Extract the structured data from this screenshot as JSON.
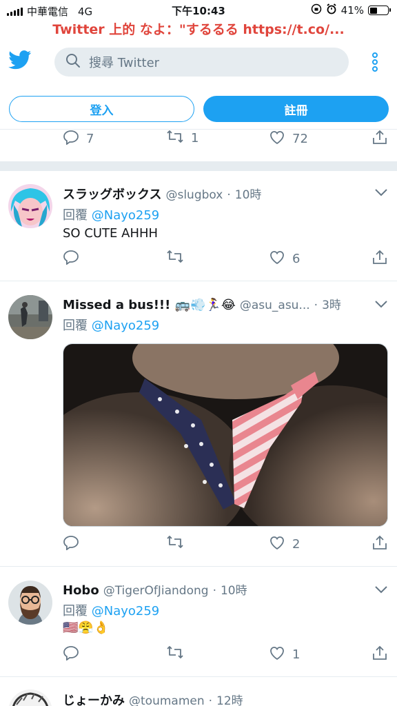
{
  "status_bar": {
    "carrier": "中華電信",
    "network": "4G",
    "time": "下午10:43",
    "battery": "41%",
    "battery_level": 0.41
  },
  "banner": "Twitter 上的 なよ：\"するるる https://t.co/...",
  "header": {
    "search_placeholder": "搜尋 Twitter"
  },
  "auth": {
    "login_label": "登入",
    "signup_label": "註冊"
  },
  "top_actions": {
    "reply_count": "7",
    "retweet_count": "1",
    "like_count": "72"
  },
  "tweets": [
    {
      "name": "スラッグボックス",
      "handle": "@slugbox",
      "time": "10時",
      "reply_prefix": "回覆",
      "reply_to": "@Nayo259",
      "text": "SO CUTE AHHH",
      "reply_count": "",
      "retweet_count": "",
      "like_count": "6"
    },
    {
      "name": "Missed a bus!!! 🚌💨🏃‍♀️😂",
      "handle": "@asu_asu...",
      "time": "3時",
      "reply_prefix": "回覆",
      "reply_to": "@Nayo259",
      "text": "",
      "reply_count": "",
      "retweet_count": "",
      "like_count": "2"
    },
    {
      "name": "Hobo",
      "handle": "@TigerOfJiandong",
      "time": "10時",
      "reply_prefix": "回覆",
      "reply_to": "@Nayo259",
      "text": "🇺🇸😤👌",
      "reply_count": "",
      "retweet_count": "",
      "like_count": "1"
    },
    {
      "name": "じょーかみ",
      "handle": "@toumamen",
      "time": "12時"
    }
  ],
  "colors": {
    "accent": "#1da1f2",
    "secondary_text": "#657786",
    "banner_text": "#e0453c",
    "divider": "#e6ecf0"
  }
}
